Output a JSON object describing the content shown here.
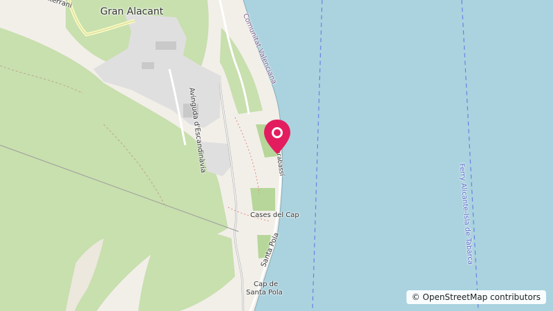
{
  "map": {
    "labels": {
      "town": "Gran Alacant",
      "top_left_road": "Interrani",
      "road_escandinavia": "Avinguda d'Escandinàvia",
      "region_coast": "Comunitat Valenciana",
      "street_carabassi": "Carabassí",
      "place_cases_del_cap": "Cases del Cap",
      "road_santa_pola": "Santa Pola",
      "cape_line1": "Cap de",
      "cape_line2": "Santa Pola",
      "ferry_route": "Ferry Alicante-Isla de Tabarca"
    },
    "attribution": {
      "symbol": "©",
      "text": "OpenStreetMap contributors"
    },
    "marker": {
      "icon": "location-pin-icon",
      "color": "#e31c5f"
    },
    "colors": {
      "sea": "#aad3df",
      "land": "#f2efe9",
      "vegetation": "#c8dfae",
      "residential": "#e0dfdf",
      "ferry_line": "#6b7fe0"
    }
  }
}
